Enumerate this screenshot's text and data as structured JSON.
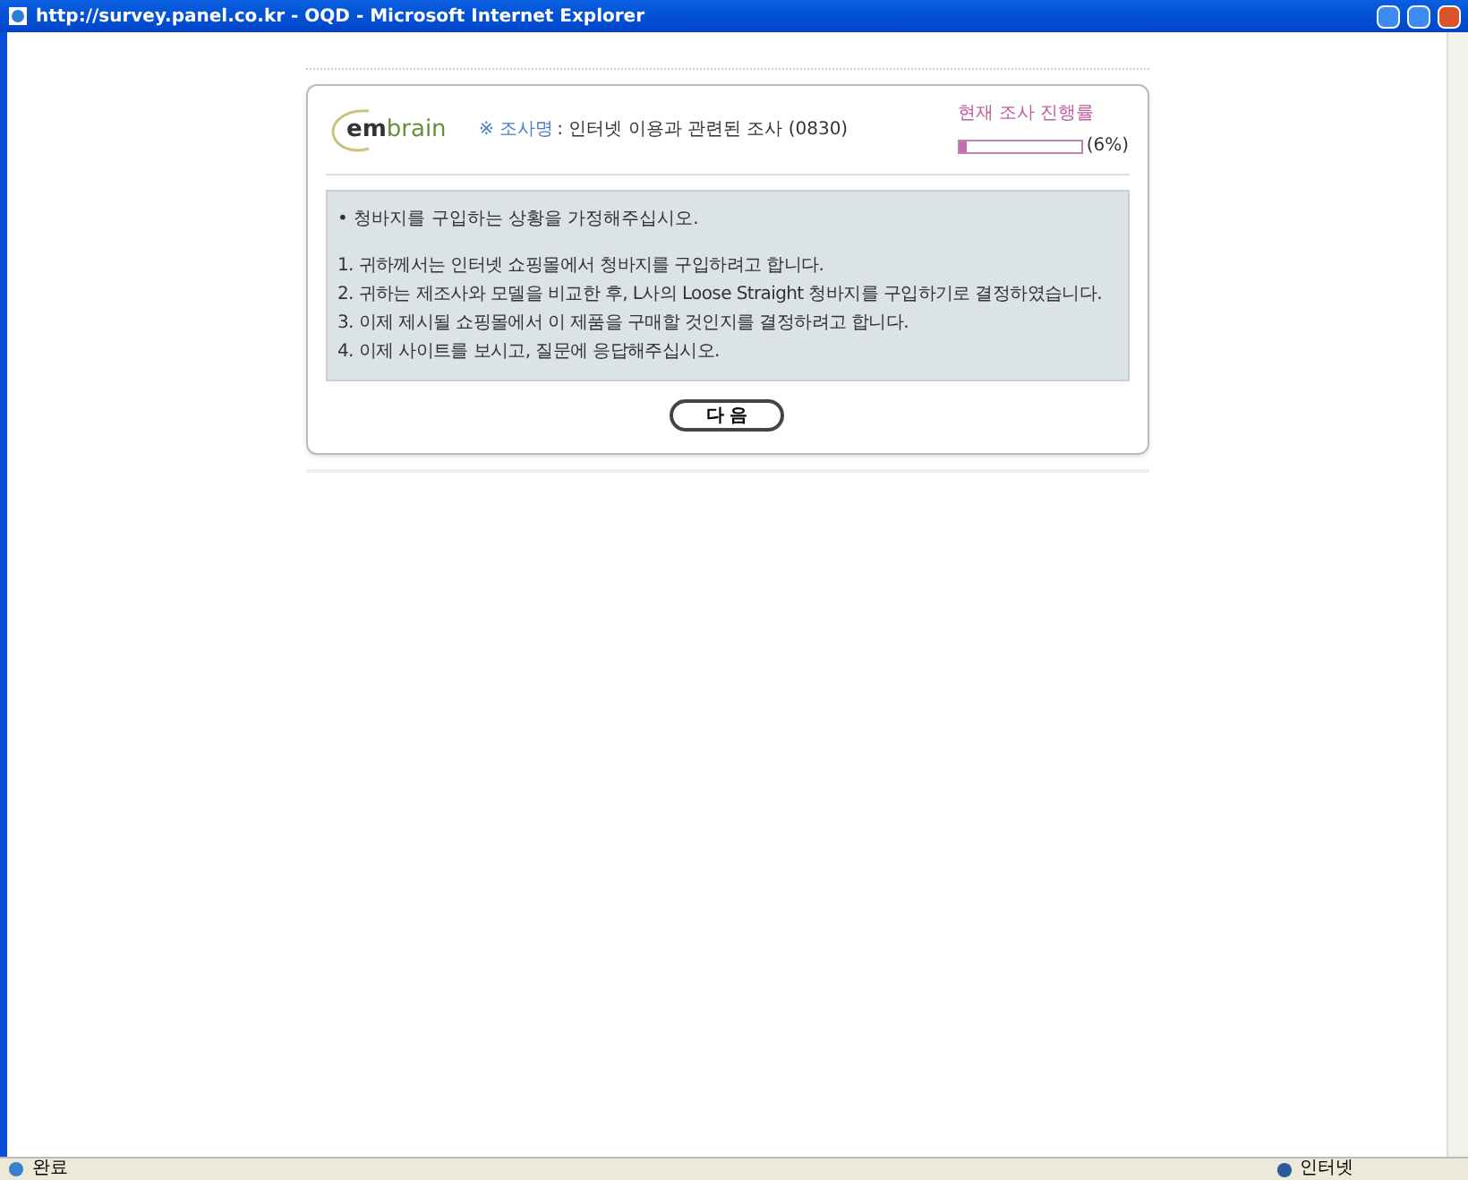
{
  "window": {
    "title": "http://survey.panel.co.kr - OQD - Microsoft Internet Explorer"
  },
  "header": {
    "logo_em": "em",
    "logo_brain": "brain",
    "survey_label": "※ 조사명",
    "survey_name": ": 인터넷 이용과 관련된 조사 (0830)",
    "progress_label": "현재 조사 진행률",
    "progress": {
      "level": 0.06,
      "reading": "(6%)"
    }
  },
  "instructions": {
    "intro": "• 청바지를 구입하는 상황을 가정해주십시오.",
    "items": [
      "1. 귀하께서는 인터넷 쇼핑몰에서 청바지를 구입하려고 합니다.",
      "2. 귀하는 제조사와 모델을 비교한 후, L사의 Loose Straight 청바지를 구입하기로 결정하였습니다.",
      "3. 이제 제시될 쇼핑몰에서 이 제품을 구매할 것인지를 결정하려고 합니다.",
      "4. 이제 사이트를 보시고, 질문에 응답해주십시오."
    ]
  },
  "next_button": "다 음",
  "status_bar": {
    "status": "완료",
    "zone": "인터넷"
  }
}
